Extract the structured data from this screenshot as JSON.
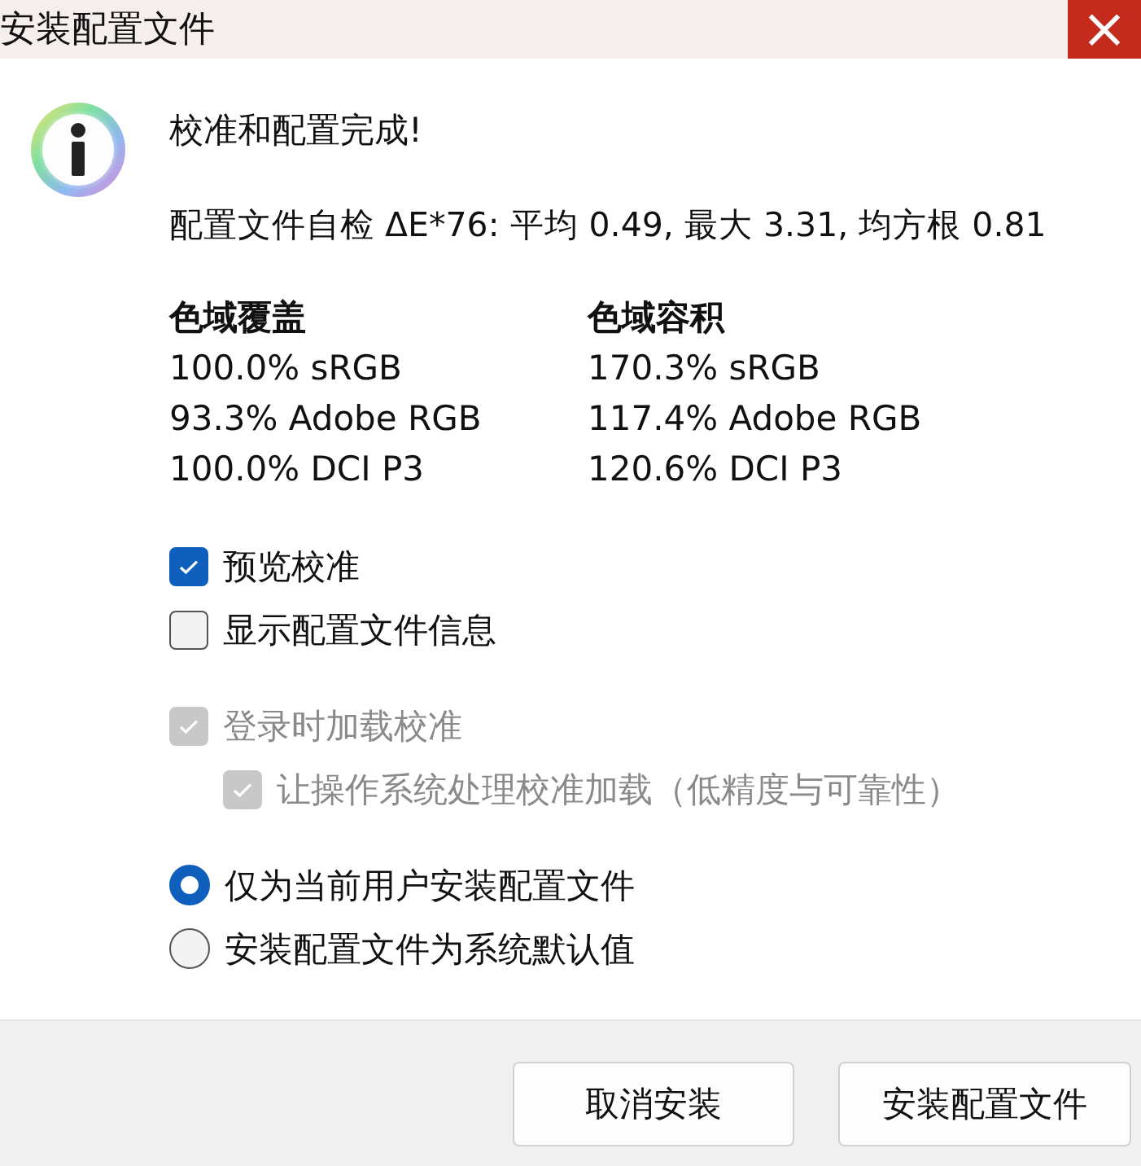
{
  "window": {
    "title": "安装配置文件",
    "close": "×"
  },
  "message": "校准和配置完成!",
  "self_check": "配置文件自检 ΔE*76: 平均 0.49, 最大 3.31, 均方根 0.81",
  "gamut": [
    {
      "heading": "色域覆盖",
      "rows": [
        "100.0% sRGB",
        "93.3% Adobe RGB",
        "100.0% DCI P3"
      ]
    },
    {
      "heading": "色域容积",
      "rows": [
        "170.3% sRGB",
        "117.4% Adobe RGB",
        "120.6% DCI P3"
      ]
    }
  ],
  "checkbox_groups": [
    [
      {
        "label": "预览校准",
        "checked": true,
        "disabled": false
      },
      {
        "label": "显示配置文件信息",
        "checked": false,
        "disabled": false
      }
    ],
    [
      {
        "label": "登录时加载校准",
        "checked": true,
        "disabled": true,
        "children": [
          {
            "label": "让操作系统处理校准加载（低精度与可靠性）",
            "checked": true,
            "disabled": true
          }
        ]
      }
    ]
  ],
  "radios": [
    {
      "label": "仅为当前用户安装配置文件",
      "selected": true
    },
    {
      "label": "安装配置文件为系统默认值",
      "selected": false
    }
  ],
  "buttons": [
    "取消安装",
    "安装配置文件"
  ]
}
